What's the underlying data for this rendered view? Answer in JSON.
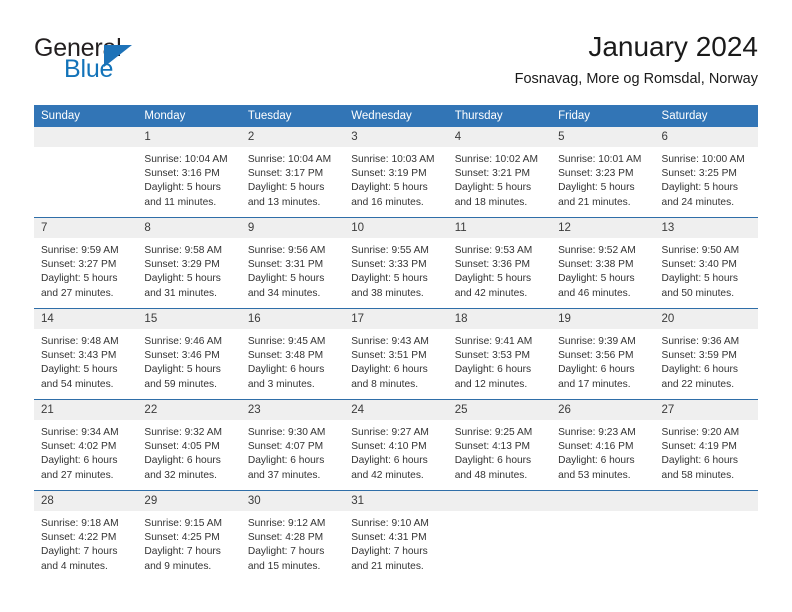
{
  "brand": {
    "name_part1": "General",
    "name_part2": "Blue",
    "triangle_color": "#1d72b8"
  },
  "header": {
    "title": "January 2024",
    "subtitle": "Fosnavag, More og Romsdal, Norway"
  },
  "colors": {
    "header_row_bg": "#3275b6",
    "daynum_bg": "#efefef",
    "week_separator": "#2f6ea8",
    "text": "#333333",
    "brand_blue": "#1273b9"
  },
  "weekday_headers": [
    "Sunday",
    "Monday",
    "Tuesday",
    "Wednesday",
    "Thursday",
    "Friday",
    "Saturday"
  ],
  "weeks": [
    [
      {
        "day": "",
        "lines": []
      },
      {
        "day": "1",
        "lines": [
          "Sunrise: 10:04 AM",
          "Sunset: 3:16 PM",
          "Daylight: 5 hours",
          "and 11 minutes."
        ]
      },
      {
        "day": "2",
        "lines": [
          "Sunrise: 10:04 AM",
          "Sunset: 3:17 PM",
          "Daylight: 5 hours",
          "and 13 minutes."
        ]
      },
      {
        "day": "3",
        "lines": [
          "Sunrise: 10:03 AM",
          "Sunset: 3:19 PM",
          "Daylight: 5 hours",
          "and 16 minutes."
        ]
      },
      {
        "day": "4",
        "lines": [
          "Sunrise: 10:02 AM",
          "Sunset: 3:21 PM",
          "Daylight: 5 hours",
          "and 18 minutes."
        ]
      },
      {
        "day": "5",
        "lines": [
          "Sunrise: 10:01 AM",
          "Sunset: 3:23 PM",
          "Daylight: 5 hours",
          "and 21 minutes."
        ]
      },
      {
        "day": "6",
        "lines": [
          "Sunrise: 10:00 AM",
          "Sunset: 3:25 PM",
          "Daylight: 5 hours",
          "and 24 minutes."
        ]
      }
    ],
    [
      {
        "day": "7",
        "lines": [
          "Sunrise: 9:59 AM",
          "Sunset: 3:27 PM",
          "Daylight: 5 hours",
          "and 27 minutes."
        ]
      },
      {
        "day": "8",
        "lines": [
          "Sunrise: 9:58 AM",
          "Sunset: 3:29 PM",
          "Daylight: 5 hours",
          "and 31 minutes."
        ]
      },
      {
        "day": "9",
        "lines": [
          "Sunrise: 9:56 AM",
          "Sunset: 3:31 PM",
          "Daylight: 5 hours",
          "and 34 minutes."
        ]
      },
      {
        "day": "10",
        "lines": [
          "Sunrise: 9:55 AM",
          "Sunset: 3:33 PM",
          "Daylight: 5 hours",
          "and 38 minutes."
        ]
      },
      {
        "day": "11",
        "lines": [
          "Sunrise: 9:53 AM",
          "Sunset: 3:36 PM",
          "Daylight: 5 hours",
          "and 42 minutes."
        ]
      },
      {
        "day": "12",
        "lines": [
          "Sunrise: 9:52 AM",
          "Sunset: 3:38 PM",
          "Daylight: 5 hours",
          "and 46 minutes."
        ]
      },
      {
        "day": "13",
        "lines": [
          "Sunrise: 9:50 AM",
          "Sunset: 3:40 PM",
          "Daylight: 5 hours",
          "and 50 minutes."
        ]
      }
    ],
    [
      {
        "day": "14",
        "lines": [
          "Sunrise: 9:48 AM",
          "Sunset: 3:43 PM",
          "Daylight: 5 hours",
          "and 54 minutes."
        ]
      },
      {
        "day": "15",
        "lines": [
          "Sunrise: 9:46 AM",
          "Sunset: 3:46 PM",
          "Daylight: 5 hours",
          "and 59 minutes."
        ]
      },
      {
        "day": "16",
        "lines": [
          "Sunrise: 9:45 AM",
          "Sunset: 3:48 PM",
          "Daylight: 6 hours",
          "and 3 minutes."
        ]
      },
      {
        "day": "17",
        "lines": [
          "Sunrise: 9:43 AM",
          "Sunset: 3:51 PM",
          "Daylight: 6 hours",
          "and 8 minutes."
        ]
      },
      {
        "day": "18",
        "lines": [
          "Sunrise: 9:41 AM",
          "Sunset: 3:53 PM",
          "Daylight: 6 hours",
          "and 12 minutes."
        ]
      },
      {
        "day": "19",
        "lines": [
          "Sunrise: 9:39 AM",
          "Sunset: 3:56 PM",
          "Daylight: 6 hours",
          "and 17 minutes."
        ]
      },
      {
        "day": "20",
        "lines": [
          "Sunrise: 9:36 AM",
          "Sunset: 3:59 PM",
          "Daylight: 6 hours",
          "and 22 minutes."
        ]
      }
    ],
    [
      {
        "day": "21",
        "lines": [
          "Sunrise: 9:34 AM",
          "Sunset: 4:02 PM",
          "Daylight: 6 hours",
          "and 27 minutes."
        ]
      },
      {
        "day": "22",
        "lines": [
          "Sunrise: 9:32 AM",
          "Sunset: 4:05 PM",
          "Daylight: 6 hours",
          "and 32 minutes."
        ]
      },
      {
        "day": "23",
        "lines": [
          "Sunrise: 9:30 AM",
          "Sunset: 4:07 PM",
          "Daylight: 6 hours",
          "and 37 minutes."
        ]
      },
      {
        "day": "24",
        "lines": [
          "Sunrise: 9:27 AM",
          "Sunset: 4:10 PM",
          "Daylight: 6 hours",
          "and 42 minutes."
        ]
      },
      {
        "day": "25",
        "lines": [
          "Sunrise: 9:25 AM",
          "Sunset: 4:13 PM",
          "Daylight: 6 hours",
          "and 48 minutes."
        ]
      },
      {
        "day": "26",
        "lines": [
          "Sunrise: 9:23 AM",
          "Sunset: 4:16 PM",
          "Daylight: 6 hours",
          "and 53 minutes."
        ]
      },
      {
        "day": "27",
        "lines": [
          "Sunrise: 9:20 AM",
          "Sunset: 4:19 PM",
          "Daylight: 6 hours",
          "and 58 minutes."
        ]
      }
    ],
    [
      {
        "day": "28",
        "lines": [
          "Sunrise: 9:18 AM",
          "Sunset: 4:22 PM",
          "Daylight: 7 hours",
          "and 4 minutes."
        ]
      },
      {
        "day": "29",
        "lines": [
          "Sunrise: 9:15 AM",
          "Sunset: 4:25 PM",
          "Daylight: 7 hours",
          "and 9 minutes."
        ]
      },
      {
        "day": "30",
        "lines": [
          "Sunrise: 9:12 AM",
          "Sunset: 4:28 PM",
          "Daylight: 7 hours",
          "and 15 minutes."
        ]
      },
      {
        "day": "31",
        "lines": [
          "Sunrise: 9:10 AM",
          "Sunset: 4:31 PM",
          "Daylight: 7 hours",
          "and 21 minutes."
        ]
      },
      {
        "day": "",
        "lines": []
      },
      {
        "day": "",
        "lines": []
      },
      {
        "day": "",
        "lines": []
      }
    ]
  ]
}
